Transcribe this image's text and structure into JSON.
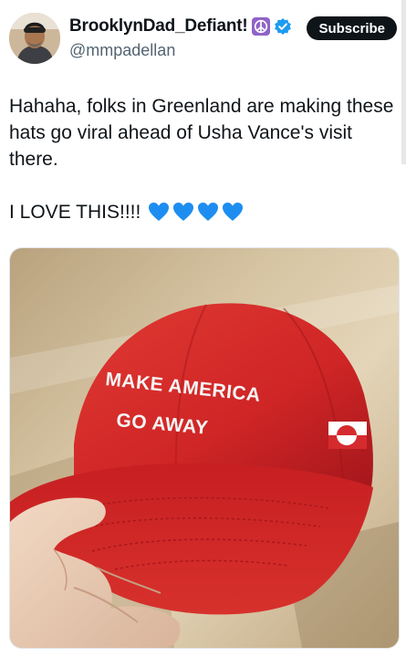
{
  "author": {
    "display_name": "BrooklynDad_Defiant!",
    "handle": "@mmpadellan",
    "peace_icon": "peace-icon",
    "verified_icon": "verified-badge-icon"
  },
  "subscribe_label": "Subscribe",
  "tweet": {
    "line1": "Hahaha, folks in Greenland are making these hats go viral ahead of Usha Vance's visit there.",
    "line2": "I LOVE THIS!!!!",
    "emoji": [
      "blue-heart-icon",
      "blue-heart-icon",
      "blue-heart-icon",
      "blue-heart-icon"
    ]
  },
  "media": {
    "hat_text_line1": "MAKE AMERICA",
    "hat_text_line2": "GO AWAY",
    "hat_color": "#d3262a",
    "flag_icon": "greenland-flag-icon"
  },
  "colors": {
    "accent": "#1d9bf0",
    "heart": "#1d8ef0",
    "text": "#0f1419",
    "muted": "#536471"
  }
}
